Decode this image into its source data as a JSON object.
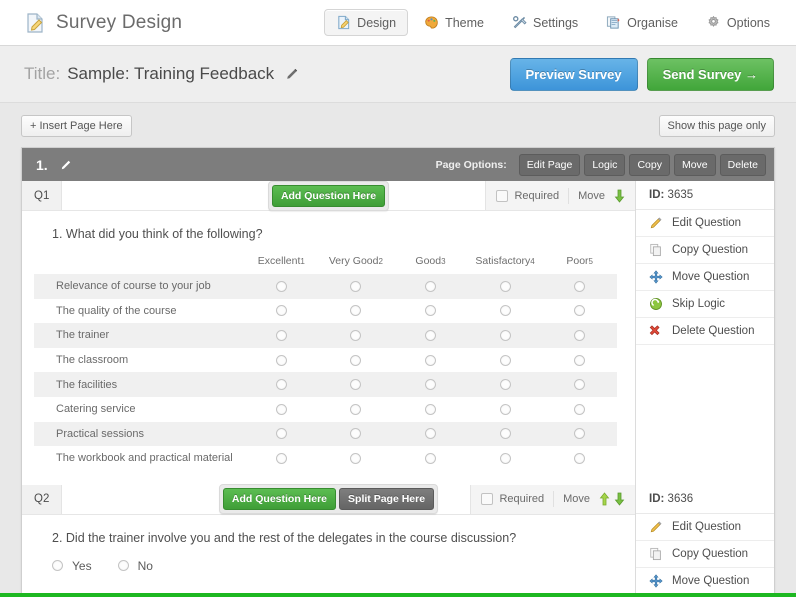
{
  "app": {
    "title": "Survey Design",
    "logo_icon": "document-edit-icon"
  },
  "nav": {
    "items": [
      {
        "label": "Design",
        "icon": "design-icon",
        "active": true
      },
      {
        "label": "Theme",
        "icon": "palette-icon",
        "active": false
      },
      {
        "label": "Settings",
        "icon": "tools-icon",
        "active": false
      },
      {
        "label": "Organise",
        "icon": "organise-icon",
        "active": false
      },
      {
        "label": "Options",
        "icon": "gear-icon",
        "active": false
      }
    ]
  },
  "titlebar": {
    "label": "Title:",
    "value": "Sample: Training Feedback",
    "edit_icon": "pencil-icon",
    "preview_label": "Preview Survey",
    "send_label": "Send Survey →"
  },
  "toolbar": {
    "insert_page_label": "+ Insert Page Here",
    "show_page_only_label": "Show this page only"
  },
  "page": {
    "number": "1.",
    "edit_icon": "pencil-icon",
    "options_label": "Page Options:",
    "options": [
      "Edit Page",
      "Logic",
      "Copy",
      "Move",
      "Delete"
    ]
  },
  "labels": {
    "required": "Required",
    "move": "Move",
    "add_question": "Add Question Here",
    "split_page": "Split Page Here",
    "id_prefix": "ID:"
  },
  "side_actions": [
    {
      "label": "Edit Question",
      "icon": "pencil-icon"
    },
    {
      "label": "Copy Question",
      "icon": "copy-icon"
    },
    {
      "label": "Move Question",
      "icon": "move-arrows-icon"
    },
    {
      "label": "Skip Logic",
      "icon": "skip-logic-icon"
    },
    {
      "label": "Delete Question",
      "icon": "delete-x-icon"
    }
  ],
  "questions": [
    {
      "tag": "Q1",
      "id": "3635",
      "text": "1. What did you think of the following?",
      "type": "matrix",
      "has_split_button": false,
      "move_up": false,
      "move_down": true,
      "columns": [
        {
          "label": "Excellent",
          "num": "1"
        },
        {
          "label": "Very Good",
          "num": "2"
        },
        {
          "label": "Good",
          "num": "3"
        },
        {
          "label": "Satisfactory",
          "num": "4"
        },
        {
          "label": "Poor",
          "num": "5"
        }
      ],
      "rows": [
        "Relevance of course to your job",
        "The quality of the course",
        "The trainer",
        "The classroom",
        "The facilities",
        "Catering service",
        "Practical sessions",
        "The workbook and practical material"
      ],
      "side_actions_visible": 5
    },
    {
      "tag": "Q2",
      "id": "3636",
      "text": "2. Did the trainer involve you and the rest of the delegates in the course discussion?",
      "type": "choice",
      "has_split_button": true,
      "move_up": true,
      "move_down": true,
      "choices": [
        "Yes",
        "No"
      ],
      "side_actions_visible": 3
    }
  ],
  "colors": {
    "green": "#41a63a",
    "blue": "#3d94d9",
    "page_header_gray": "#7d7d7d",
    "bottom_rule": "#1db821"
  }
}
